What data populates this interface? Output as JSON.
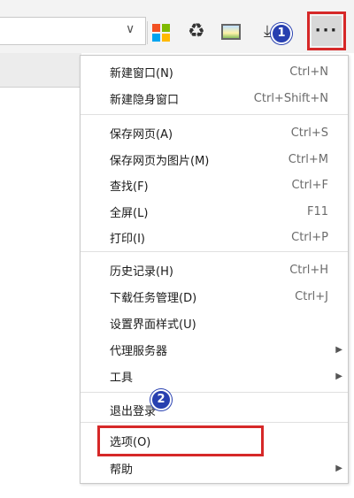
{
  "toolbar": {
    "more_label": "···",
    "badge_1": "1",
    "addr_chevron": "∨",
    "icons": [
      "ms-tiles-icon",
      "recycle-icon",
      "image-icon",
      "download-icon"
    ],
    "recycle_glyph": "♻",
    "download_glyph": "⤓"
  },
  "menu": {
    "badge_2": "2",
    "groups": [
      [
        {
          "label": "新建窗口(N)",
          "shortcut": "Ctrl+N"
        },
        {
          "label": "新建隐身窗口",
          "shortcut": "Ctrl+Shift+N"
        }
      ],
      [
        {
          "label": "保存网页(A)",
          "shortcut": "Ctrl+S"
        },
        {
          "label": "保存网页为图片(M)",
          "shortcut": "Ctrl+M"
        },
        {
          "label": "查找(F)",
          "shortcut": "Ctrl+F"
        },
        {
          "label": "全屏(L)",
          "shortcut": "F11"
        },
        {
          "label": "打印(I)",
          "shortcut": "Ctrl+P"
        }
      ],
      [
        {
          "label": "历史记录(H)",
          "shortcut": "Ctrl+H"
        },
        {
          "label": "下载任务管理(D)",
          "shortcut": "Ctrl+J"
        },
        {
          "label": "设置界面样式(U)",
          "shortcut": ""
        },
        {
          "label": "代理服务器",
          "shortcut": "",
          "submenu": true
        },
        {
          "label": "工具",
          "shortcut": "",
          "submenu": true
        }
      ],
      [
        {
          "label": "退出登录",
          "shortcut": ""
        }
      ],
      [
        {
          "label": "选项(O)",
          "shortcut": ""
        },
        {
          "label": "帮助",
          "shortcut": "",
          "submenu": true
        }
      ]
    ],
    "submenu_arrow": "▶"
  },
  "colors": {
    "highlight": "#d62828",
    "badge": "#2840b0",
    "ms_tiles": [
      "#f25022",
      "#7fba00",
      "#00a4ef",
      "#ffb900"
    ]
  }
}
